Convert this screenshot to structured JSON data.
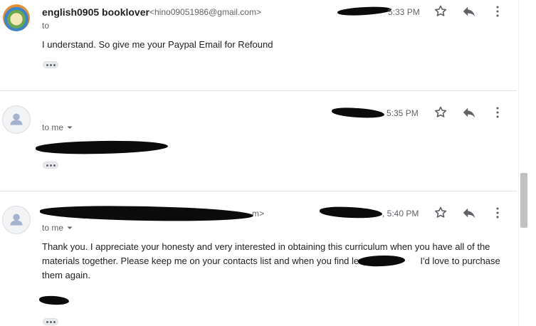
{
  "messages": [
    {
      "sender_name": "english0905 booklover",
      "sender_email": "<hino09051986@gmail.com>",
      "time": "5:33 PM",
      "to": "to",
      "body": "I understand.  So give me your Paypal Email for Refound"
    },
    {
      "time": "5:35 PM",
      "to": "to me"
    },
    {
      "sender_email_tail": "m>",
      "time": ", 5:40 PM",
      "to": "to me",
      "body": "Thank you. I appreciate your honesty and very interested in obtaining this curriculum when you have all of the materials together. Please keep me on your contacts list and when you find level",
      "body_tail": " I'd love to purchase",
      "body_line3": "them again."
    }
  ],
  "icons": {
    "star": "star-icon",
    "reply": "reply-icon",
    "more": "more-vert-icon",
    "dropdown": "arrow-drop-down-icon",
    "avatar": "person-avatar-icon"
  },
  "colors": {
    "time_text": "#5f6368",
    "icon": "#5f6368",
    "redaction": "#0b0b0b"
  }
}
